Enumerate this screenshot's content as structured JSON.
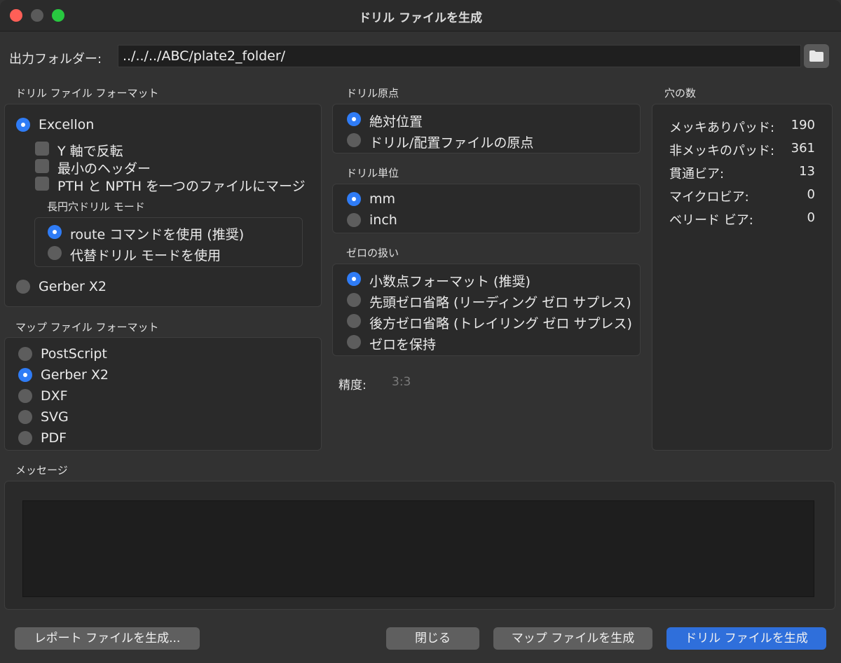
{
  "window": {
    "title": "ドリル ファイルを生成"
  },
  "output": {
    "label": "出力フォルダー:",
    "path": "../../../ABC/plate2_folder/",
    "folder_icon": "folder-icon"
  },
  "drill_format": {
    "title": "ドリル ファイル フォーマット",
    "excellon": "Excellon",
    "mirror_y": "Y 軸で反転",
    "minimal_header": "最小のヘッダー",
    "merge_pth": "PTH と NPTH を一つのファイルにマージ",
    "oval_title": "長円穴ドリル モード",
    "route_cmd": "route コマンドを使用 (推奨)",
    "alt_mode": "代替ドリル モードを使用",
    "gerber_x2": "Gerber X2"
  },
  "map_format": {
    "title": "マップ ファイル フォーマット",
    "options": [
      "PostScript",
      "Gerber X2",
      "DXF",
      "SVG",
      "PDF"
    ]
  },
  "drill_origin": {
    "title": "ドリル原点",
    "absolute": "絶対位置",
    "aux": "ドリル/配置ファイルの原点"
  },
  "drill_units": {
    "title": "ドリル単位",
    "mm": "mm",
    "inch": "inch"
  },
  "zeros": {
    "title": "ゼロの扱い",
    "decimal": "小数点フォーマット (推奨)",
    "leading": "先頭ゼロ省略 (リーディング ゼロ サプレス)",
    "trailing": "後方ゼロ省略 (トレイリング ゼロ サプレス)",
    "keep": "ゼロを保持"
  },
  "precision": {
    "label": "精度:",
    "value": "3:3"
  },
  "hole_count": {
    "title": "穴の数",
    "plated_label": "メッキありパッド:",
    "plated": "190",
    "nonplated_label": "非メッキのパッド:",
    "nonplated": "361",
    "through_label": "貫通ビア:",
    "through": "13",
    "micro_label": "マイクロビア:",
    "micro": "0",
    "buried_label": "ベリード ビア:",
    "buried": "0"
  },
  "messages": {
    "title": "メッセージ"
  },
  "buttons": {
    "report": "レポート ファイルを生成...",
    "close": "閉じる",
    "map": "マップ ファイルを生成",
    "drill": "ドリル ファイルを生成"
  },
  "colors": {
    "accent": "#2f7cf6",
    "primary_button": "#2f6fdb"
  }
}
